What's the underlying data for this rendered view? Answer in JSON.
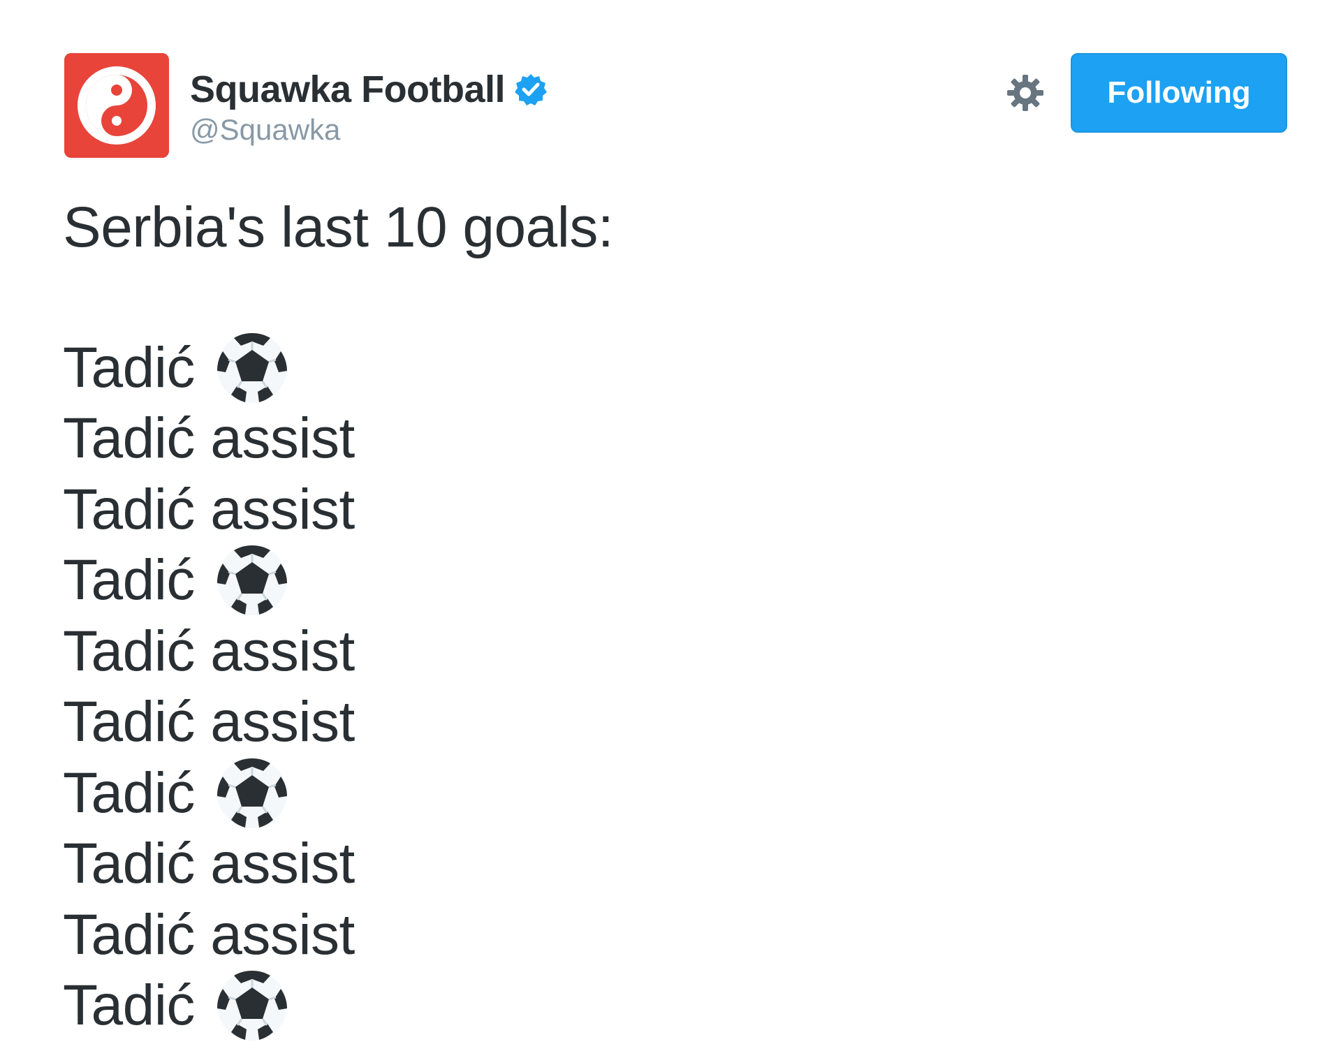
{
  "account": {
    "display_name": "Squawka Football",
    "handle": "@Squawka",
    "verified": true,
    "avatar_icon": "squawka-logo",
    "avatar_color": "#e8443a"
  },
  "actions": {
    "settings_icon": "gear-icon",
    "follow_label": "Following",
    "follow_color": "#1da1f2"
  },
  "tweet": {
    "intro": "Serbia's last 10 goals:",
    "lines": [
      {
        "name": "Tadić",
        "type": "goal",
        "text": "",
        "icon": "soccer-ball-icon"
      },
      {
        "name": "Tadić",
        "type": "assist",
        "text": "assist"
      },
      {
        "name": "Tadić",
        "type": "assist",
        "text": "assist"
      },
      {
        "name": "Tadić",
        "type": "goal",
        "text": "",
        "icon": "soccer-ball-icon"
      },
      {
        "name": "Tadić",
        "type": "assist",
        "text": "assist"
      },
      {
        "name": "Tadić",
        "type": "assist",
        "text": "assist"
      },
      {
        "name": "Tadić",
        "type": "goal",
        "text": "",
        "icon": "soccer-ball-icon"
      },
      {
        "name": "Tadić",
        "type": "assist",
        "text": "assist"
      },
      {
        "name": "Tadić",
        "type": "assist",
        "text": "assist"
      },
      {
        "name": "Tadić",
        "type": "goal",
        "text": "",
        "icon": "soccer-ball-icon"
      }
    ]
  }
}
